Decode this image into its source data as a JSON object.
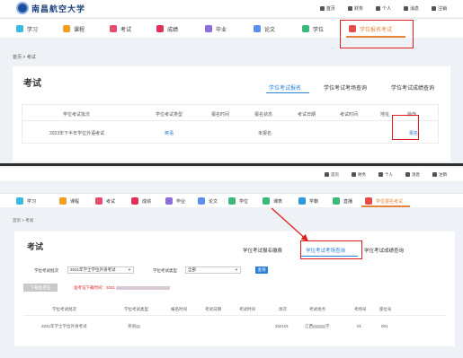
{
  "brand": {
    "name": "南昌航空大学",
    "subtitle": "NANCHANG HANGKONG UNIVERSITY"
  },
  "topnav": [
    {
      "icon": "home-icon",
      "label": "首页"
    },
    {
      "icon": "finance-icon",
      "label": "财务"
    },
    {
      "icon": "user-icon",
      "label": "个人"
    },
    {
      "icon": "bell-icon",
      "label": "消息"
    },
    {
      "icon": "logout-icon",
      "label": "注销"
    }
  ],
  "menu1": [
    {
      "label": "学习",
      "color": "#3fb8e0"
    },
    {
      "label": "课程",
      "color": "#f0a020"
    },
    {
      "label": "考试",
      "color": "#e84a6a"
    },
    {
      "label": "成绩",
      "color": "#e0305a"
    },
    {
      "label": "毕业",
      "color": "#8a6fd8"
    },
    {
      "label": "论文",
      "color": "#5a8ff0"
    },
    {
      "label": "学位",
      "color": "#3cb878"
    },
    {
      "label": "学位报名考试",
      "color": "#e84a4a"
    }
  ],
  "menu2": [
    {
      "label": "学习",
      "color": "#3fb8e0"
    },
    {
      "label": "课程",
      "color": "#f0a020"
    },
    {
      "label": "考试",
      "color": "#e84a6a"
    },
    {
      "label": "成绩",
      "color": "#e0305a"
    },
    {
      "label": "毕业",
      "color": "#8a6fd8"
    },
    {
      "label": "论文",
      "color": "#5a8ff0"
    },
    {
      "label": "学位",
      "color": "#3cb878"
    },
    {
      "label": "课表",
      "color": "#3cb878"
    },
    {
      "label": "学籍",
      "color": "#2a9ad8"
    },
    {
      "label": "直播",
      "color": "#3cb878"
    },
    {
      "label": "学位报名考试",
      "color": "#e84a4a"
    }
  ],
  "breadcrumb": "首页 > 考试",
  "section1": {
    "title": "考试",
    "tabs": [
      "学位考试报名",
      "学位考试考场查询",
      "学位考试成绩查询"
    ],
    "headers": [
      "学位考试批次",
      "学位考试类型",
      "报名时间",
      "报名状态",
      "考试日期",
      "考试时间",
      "地址",
      "操作"
    ],
    "row": {
      "batch": "2023年下半年学位外语考试",
      "type": "英语",
      "status": "未报名",
      "action": "报名"
    }
  },
  "section2": {
    "title": "考试",
    "tabs": [
      "学位考试报名缴费",
      "学位考试考场查询",
      "学位考试成绩查询"
    ],
    "filters": {
      "batch_label": "学位考试批次",
      "batch_value": "2021年学士学位外语考试",
      "type_label": "学位考试类型",
      "type_value": "全部",
      "query": "查询"
    },
    "download": "下载准考证",
    "note": "准考证下载时间：2021",
    "headers": [
      "学位考试批次",
      "学位考试类型",
      "报名时间",
      "考试日期",
      "考试时间",
      "场次",
      "考试地点",
      "考场号",
      "座位号"
    ],
    "row": {
      "batch": "2021年学士学位外语考试",
      "type": "英语",
      "session": "202101",
      "location_a": "江西",
      "location_b": "学",
      "room": "01",
      "seat": "001"
    }
  }
}
